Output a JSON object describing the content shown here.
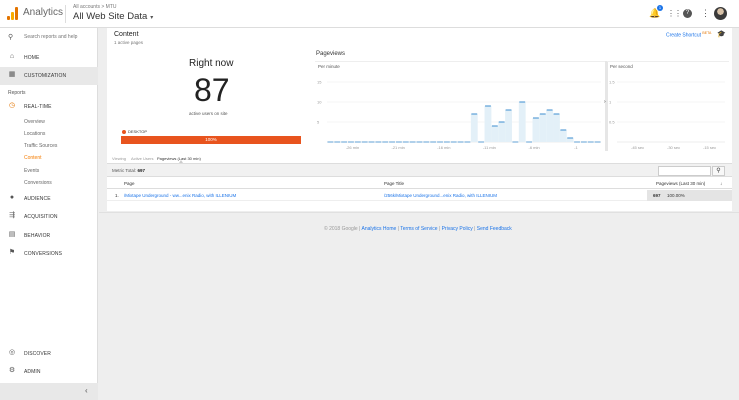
{
  "header": {
    "brand": "Analytics",
    "breadcrumb": "All accounts > MTU",
    "property": "All Web Site Data",
    "notification_count": "1"
  },
  "sidebar": {
    "search_placeholder": "Search reports and help",
    "home": "HOME",
    "customization": "CUSTOMIZATION",
    "reports_header": "Reports",
    "realtime": "REAL-TIME",
    "realtime_items": [
      "Overview",
      "Locations",
      "Traffic Sources",
      "Content",
      "Events",
      "Conversions"
    ],
    "active_item": "Content",
    "audience": "AUDIENCE",
    "acquisition": "ACQUISITION",
    "behavior": "BEHAVIOR",
    "conversions": "CONVERSIONS",
    "discover": "DISCOVER",
    "admin": "ADMIN"
  },
  "content": {
    "title": "Content",
    "subtitle": "1 active pages",
    "shortcut": "Create Shortcut",
    "beta": "BETA",
    "right_now_title": "Right now",
    "active_users": "87",
    "active_users_label": "active users on site",
    "device_label": "DESKTOP",
    "device_percent": "100%",
    "pageviews_title": "Pageviews",
    "per_minute": "Per minute",
    "per_second": "Per second",
    "tabs": [
      "Viewing",
      "Active Users",
      "Pageviews (Last 30 min)"
    ],
    "metric_label": "Metric Total:",
    "metric_total": "697",
    "col_page": "Page",
    "col_page_title": "Page Title",
    "col_pageviews": "Pageviews (Last 30 min)",
    "rows": [
      {
        "index": "1.",
        "page": "/Mixtape Underground - ww...enix Radio, with ILLENIUM",
        "page_title": "/256k/Mixtape Underground...enix Radio, with ILLENIUM",
        "pageviews": "697",
        "percent": "100.00%"
      }
    ]
  },
  "footer": {
    "copyright": "© 2018 Google |",
    "links": [
      "Analytics Home",
      "Terms of Service",
      "Privacy Policy",
      "Send Feedback"
    ]
  },
  "chart_data": [
    {
      "type": "bar",
      "title": "Per minute",
      "y_ticks": [
        "15",
        "10",
        "5"
      ],
      "x_ticks": [
        "-26 min",
        "-21 min",
        "-16 min",
        "-11 min",
        "-6 min",
        "-1"
      ],
      "ylim": [
        0,
        17
      ],
      "values": [
        0,
        0,
        0,
        0,
        0,
        0,
        0,
        0,
        0,
        0,
        0,
        0,
        0,
        0,
        0,
        0,
        0,
        0,
        0,
        0,
        0,
        7,
        0,
        9,
        4,
        5,
        8,
        0,
        10,
        0,
        6,
        7,
        8,
        7,
        3,
        1,
        0,
        0,
        0,
        0
      ],
      "color": "#7cb5d9"
    },
    {
      "type": "bar",
      "title": "Per second",
      "y_ticks": [
        "1.5",
        "1",
        "0.5"
      ],
      "x_ticks": [
        "-45 sec",
        "-30 sec",
        "-15 sec"
      ],
      "ylim": [
        0,
        1.7
      ],
      "values": [],
      "color": "#7cb5d9"
    }
  ]
}
